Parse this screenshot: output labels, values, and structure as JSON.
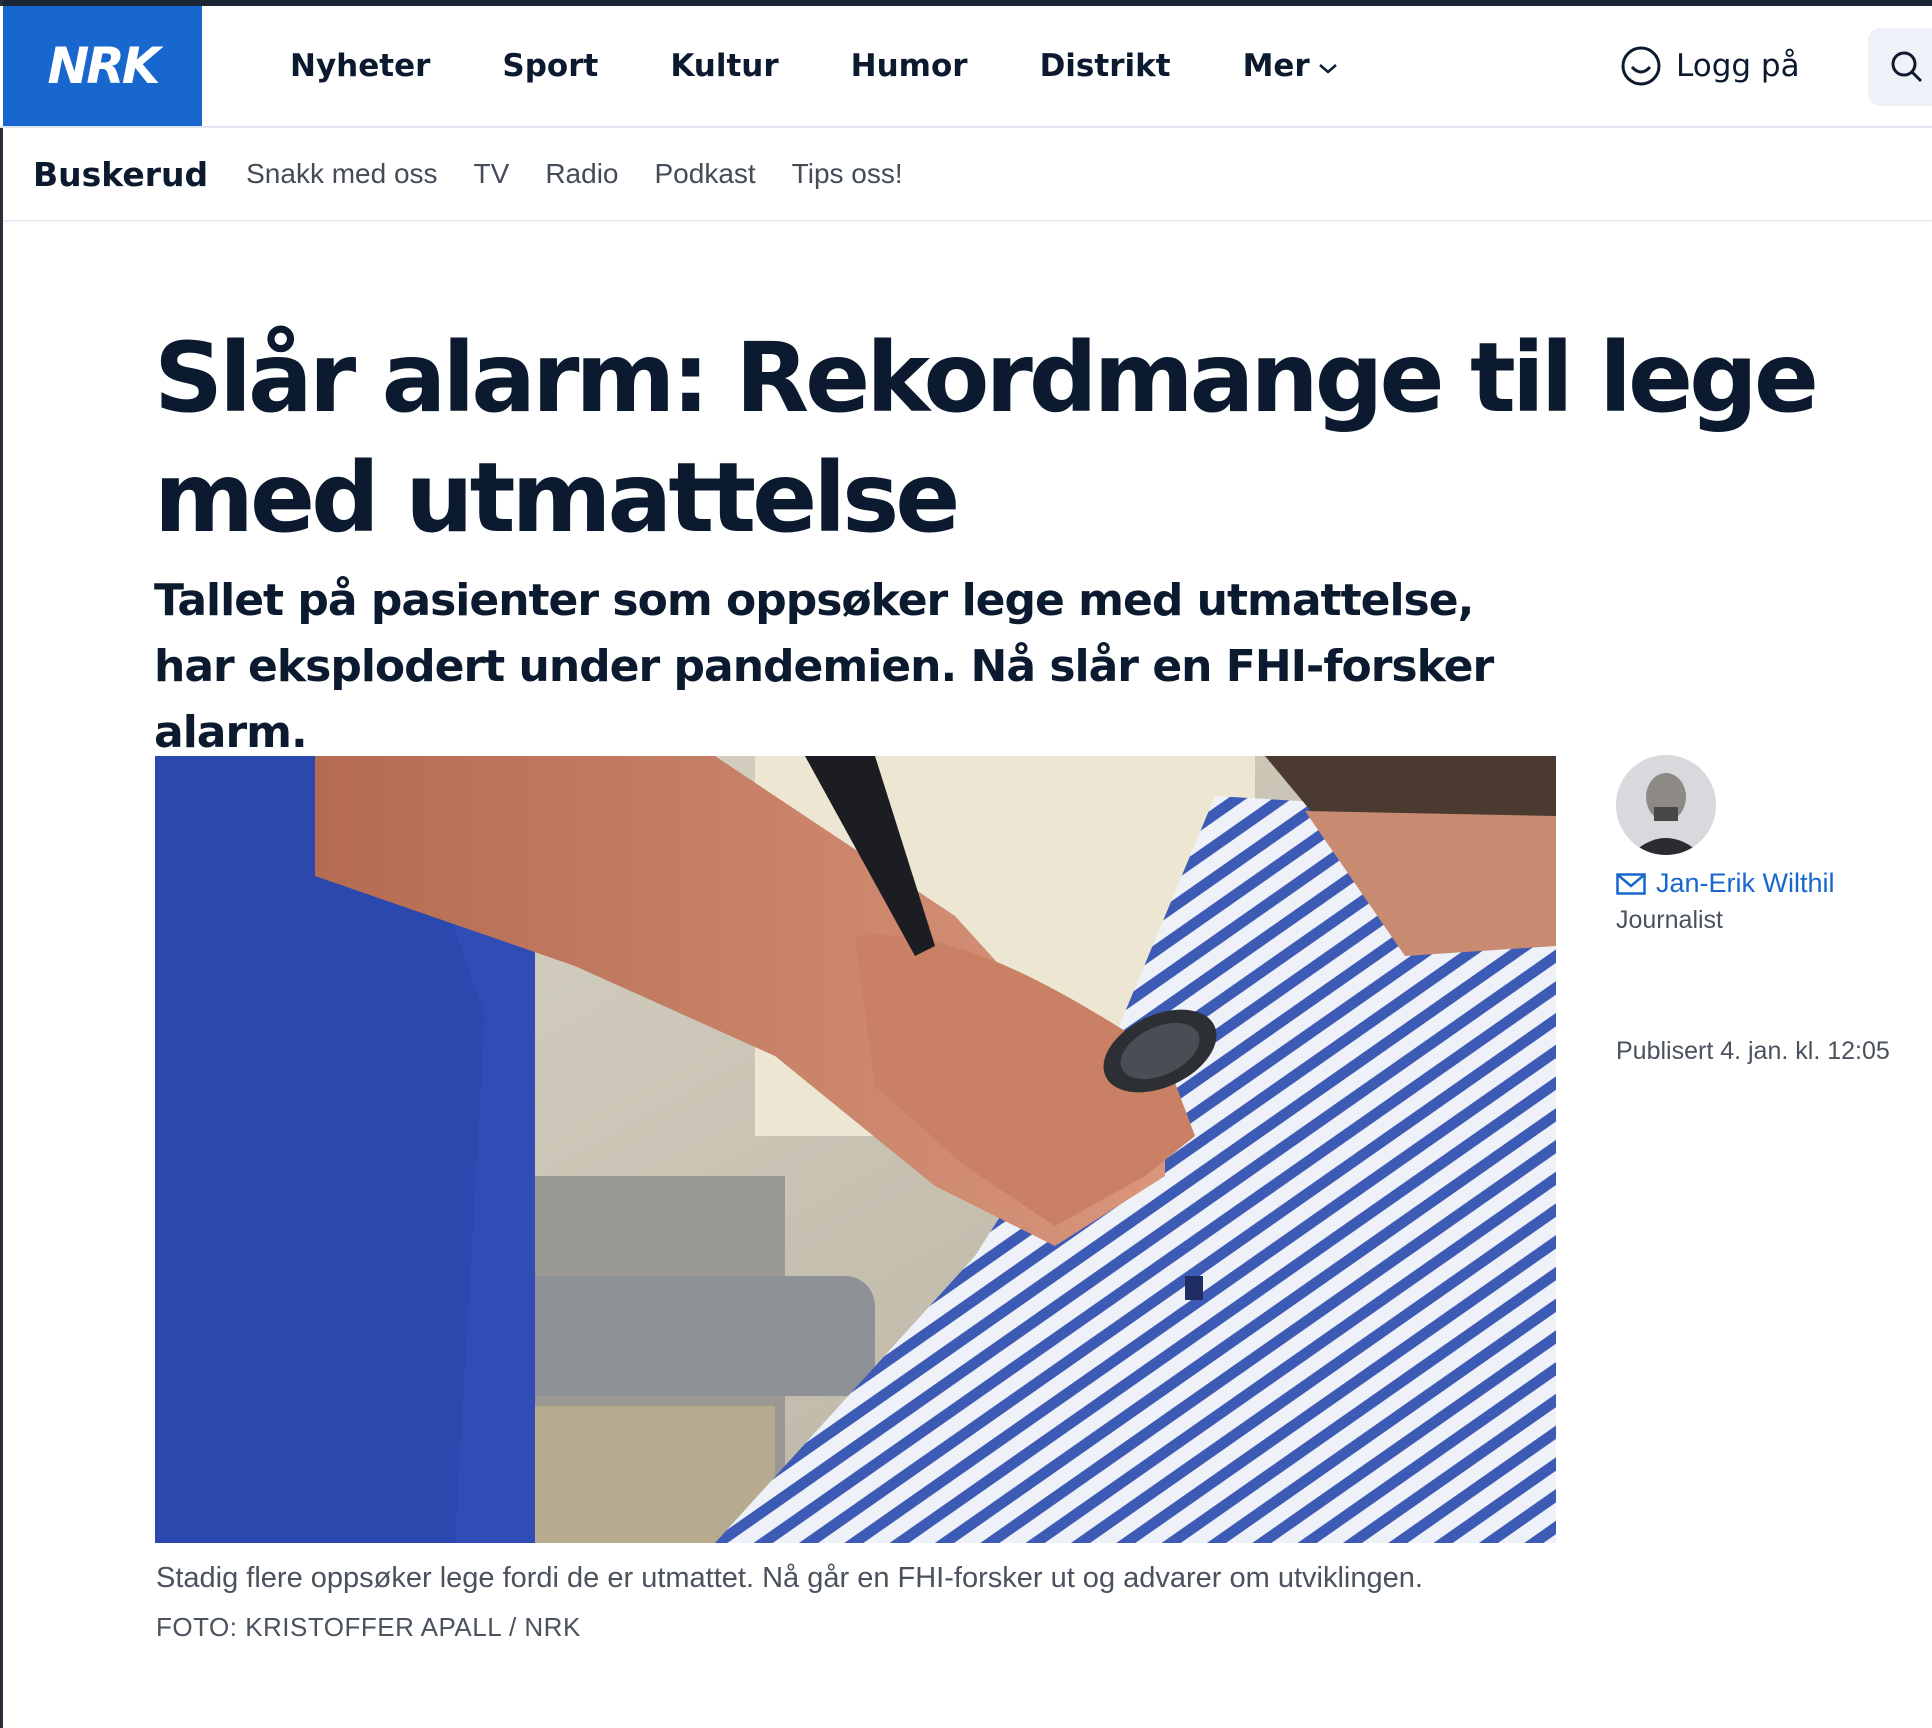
{
  "header": {
    "logo_text": "NRK",
    "nav": [
      "Nyheter",
      "Sport",
      "Kultur",
      "Humor",
      "Distrikt",
      "Mer"
    ],
    "login_label": "Logg på"
  },
  "subnav": {
    "region": "Buskerud",
    "items": [
      "Snakk med oss",
      "TV",
      "Radio",
      "Podkast",
      "Tips oss!"
    ]
  },
  "article": {
    "headline": "Slår alarm: Rekordmange til lege med utmattelse",
    "lead": "Tallet på pasienter som oppsøker lege med utmattelse, har eksplodert under pandemien. Nå slår en FHI-forsker alarm.",
    "image_caption": "Stadig flere oppsøker lege fordi de er utmattet. Nå går en FHI-forsker ut og advarer om utviklingen.",
    "image_credit": "FOTO: KRISTOFFER APALL / NRK"
  },
  "byline": {
    "author": "Jan-Erik Wilthil",
    "role": "Journalist",
    "published": "Publisert 4. jan. kl. 12:05"
  },
  "colors": {
    "brand_blue": "#1767ce",
    "text_dark": "#0b1a2e",
    "text_muted": "#4a525d"
  },
  "icons": {
    "account": "smiley-user-icon",
    "search": "search-icon",
    "email": "mail-icon",
    "menu_more": "chevron-down-icon"
  }
}
